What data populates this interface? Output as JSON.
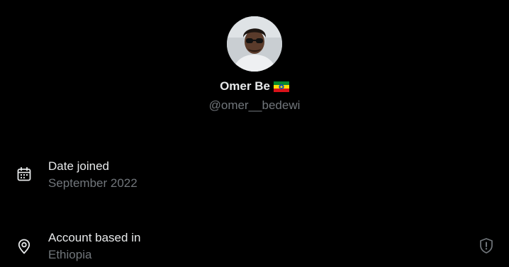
{
  "profile": {
    "display_name": "Omer Be",
    "handle": "@omer__bedewi",
    "flag_icon": "ethiopia-flag-icon"
  },
  "about": {
    "date_joined": {
      "label": "Date joined",
      "value": "September 2022",
      "icon": "calendar-icon"
    },
    "account_based_in": {
      "label": "Account based in",
      "value": "Ethiopia",
      "icon": "location-pin-icon"
    }
  },
  "info_icon": "shield-info-icon",
  "colors": {
    "background": "#000000",
    "primary_text": "#e7e9ea",
    "secondary_text": "#71767b",
    "flag_green": "#078930",
    "flag_yellow": "#fcdd09",
    "flag_red": "#da121a",
    "flag_emblem": "#0f47af"
  }
}
